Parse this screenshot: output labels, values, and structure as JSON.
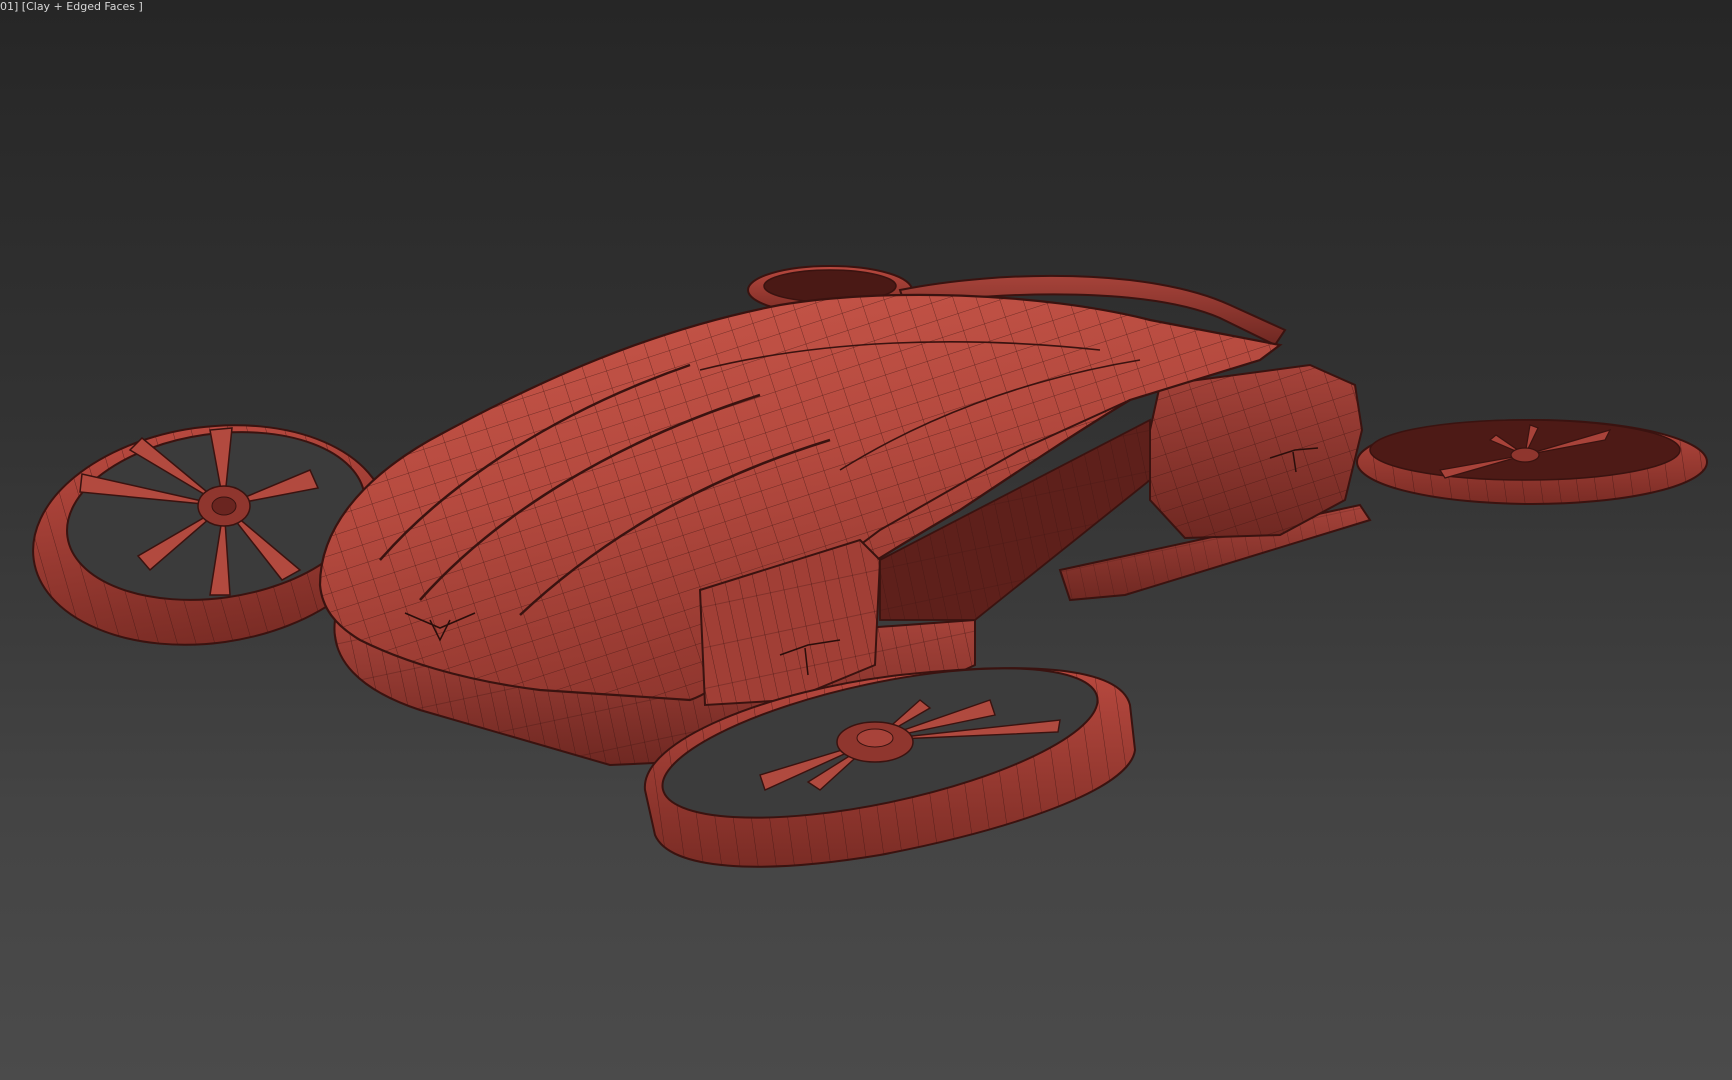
{
  "viewport": {
    "label": "01] [Clay + Edged Faces ]"
  },
  "colors": {
    "clay_light": "#c55448",
    "clay_mid": "#a8433a",
    "clay_dark": "#7b2c25",
    "clay_shadow": "#5a1d18",
    "wire": "#3a1310",
    "bg_top": "#262626",
    "bg_bottom": "#4b4b4b"
  },
  "scene": {
    "object": "flying-car-drone",
    "rotor_count": 4
  }
}
